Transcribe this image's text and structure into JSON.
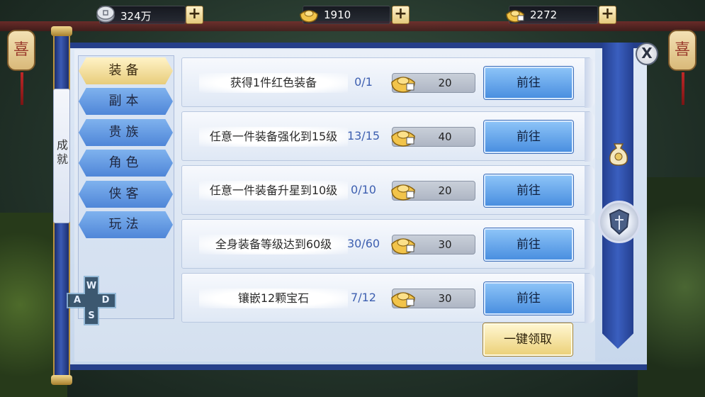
{
  "resources": [
    {
      "icon": "silver-coin-icon",
      "value": "324万"
    },
    {
      "icon": "gold-ingot-icon",
      "value": "1910"
    },
    {
      "icon": "gold-ingot-locked-icon",
      "value": "2272"
    }
  ],
  "side_label": "成就",
  "tabs": [
    {
      "label": "装备",
      "active": true
    },
    {
      "label": "副本",
      "active": false
    },
    {
      "label": "贵族",
      "active": false
    },
    {
      "label": "角色",
      "active": false
    },
    {
      "label": "侠客",
      "active": false
    },
    {
      "label": "玩法",
      "active": false
    }
  ],
  "rows": [
    {
      "title": "获得1件红色装备",
      "progress": "0/1",
      "reward": "20",
      "button": "前往"
    },
    {
      "title": "任意一件装备强化到15级",
      "progress": "13/15",
      "reward": "40",
      "button": "前往"
    },
    {
      "title": "任意一件装备升星到10级",
      "progress": "0/10",
      "reward": "20",
      "button": "前往"
    },
    {
      "title": "全身装备等级达到60级",
      "progress": "30/60",
      "reward": "30",
      "button": "前往"
    },
    {
      "title": "镶嵌12颗宝石",
      "progress": "7/12",
      "reward": "30",
      "button": "前往"
    }
  ],
  "claim_all": "一键领取",
  "close_label": "X",
  "dpad": {
    "up": "W",
    "left": "A",
    "down": "S",
    "right": "D"
  },
  "colors": {
    "accent_blue": "#4a8fe0",
    "accent_gold": "#ecd17a",
    "frame_blue": "#253f8a"
  }
}
